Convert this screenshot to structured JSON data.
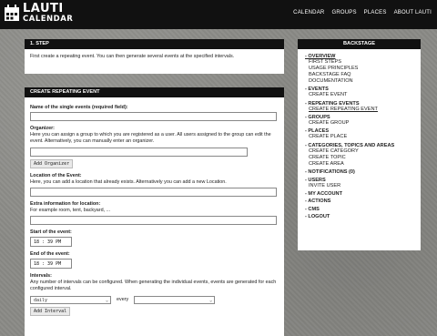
{
  "logo": {
    "line1": "LAUTI",
    "line2": "CALENDAR"
  },
  "nav": [
    "CALENDAR",
    "GROUPS",
    "PLACES",
    "ABOUT LAUTI"
  ],
  "step": {
    "title": "1. STEP",
    "text": "First create a repeating event. You can then generate several events at the specified intervals."
  },
  "form": {
    "title": "CREATE REPEATING EVENT",
    "name_label": "Name of the single events (required field):",
    "organizer_label": "Organizer:",
    "organizer_help": "Here you can assign a group to which you are registered as a user. All users assigned to the group can edit the event. Alternatively, you can manually enter an organizer.",
    "add_organizer": "Add Organizer",
    "location_label": "Location of the Event:",
    "location_help": "Here, you can add a location that already exists. Alternatively you can add a new Location.",
    "extra_label": "Extra information for location:",
    "extra_help": "For example room, tent, backyard, ...",
    "start_label": "Start of the event:",
    "start_value": "18 : 39  PM",
    "end_label": "End of the event:",
    "end_value": "18 : 39  PM",
    "intervals_label": "Intervals:",
    "intervals_help": "Any number of intervals can be configured. When generating the individual events, events are generated for each configured interval.",
    "interval_select": "daily",
    "every_label": "every",
    "add_interval": "Add Interval"
  },
  "sidebar": {
    "title": "BACKSTAGE",
    "sections": [
      {
        "label": "- OVERVIEW",
        "active": true,
        "items": [
          "FIRST STEPS",
          "USAGE PRINCIPLES",
          "BACKSTAGE FAQ",
          "DOCUMENTATION"
        ]
      },
      {
        "label": "- EVENTS",
        "items": [
          "CREATE EVENT"
        ]
      },
      {
        "label": "- REPEATING EVENTS",
        "items": [
          "CREATE REPEATING EVENT"
        ],
        "active_item": 0
      },
      {
        "label": "- GROUPS",
        "items": [
          "CREATE GROUP"
        ]
      },
      {
        "label": "- PLACES",
        "items": [
          "CREATE PLACE"
        ]
      },
      {
        "label": "- CATEGORIES, TOPICS AND AREAS",
        "items": [
          "CREATE CATEGORY",
          "CREATE TOPIC",
          "CREATE AREA"
        ]
      },
      {
        "label": "- NOTIFICATIONS (0)",
        "items": []
      },
      {
        "label": "- USERS",
        "items": [
          "INVITE USER"
        ]
      },
      {
        "label": "- MY ACCOUNT",
        "items": []
      },
      {
        "label": "- ACTIONS",
        "items": []
      },
      {
        "label": "- CMS",
        "items": []
      },
      {
        "label": "- LOGOUT",
        "items": []
      }
    ]
  },
  "icons": {
    "logo": "calendar-logo-icon",
    "dropdown": "chevron-down-icon"
  },
  "colors": {
    "header": "#111111",
    "panel": "#ffffff",
    "background": "#8a8a86"
  }
}
